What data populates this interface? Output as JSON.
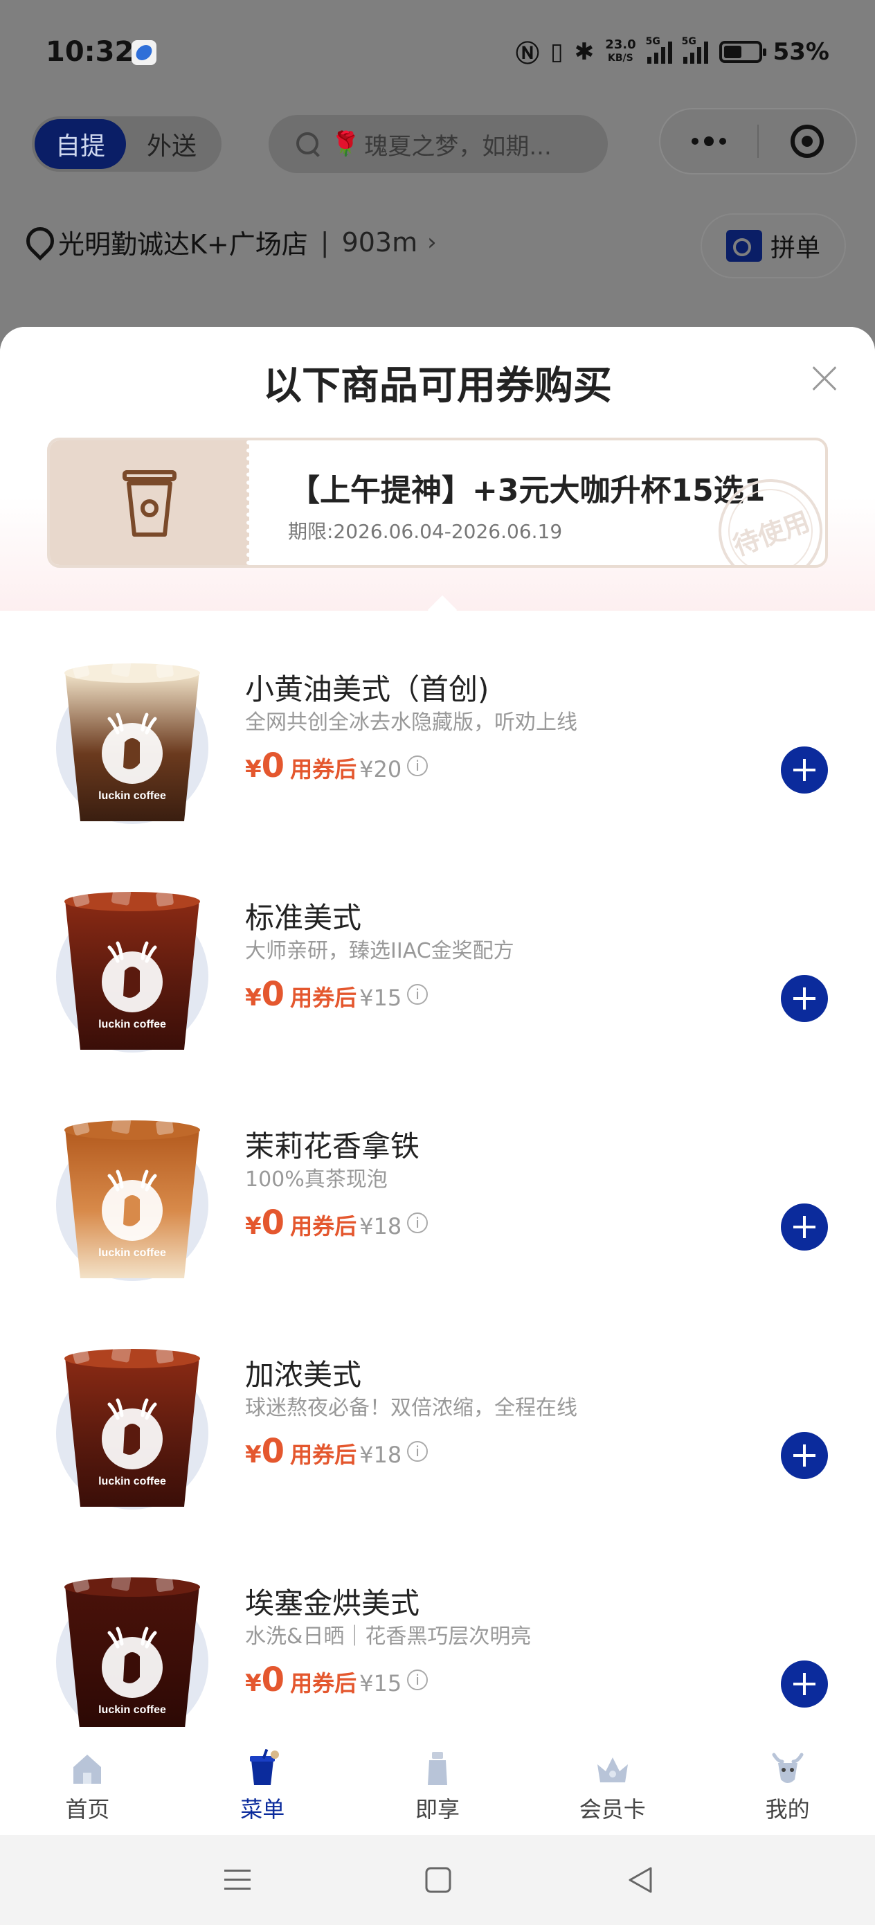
{
  "status_bar": {
    "time": "10:32",
    "network_speed": "23.0",
    "network_speed_unit": "KB/S",
    "signal_label_1": "5G",
    "signal_label_2": "5G",
    "battery_percent": "53%",
    "battery_level": 0.53
  },
  "header": {
    "mode_active": "自提",
    "mode_other": "外送",
    "search_placeholder": "瑰夏之梦，如期...",
    "store_name": "光明勤诚达K+广场店",
    "store_distance": "903m",
    "group_order_label": "拼单"
  },
  "sheet": {
    "title": "以下商品可用券购买",
    "coupon": {
      "title": "【上午提神】+3元大咖升杯15选1",
      "validity": "期限:2026.06.04-2026.06.19",
      "stamp": "待使用"
    },
    "products": [
      {
        "name": "小黄油美式（首创)",
        "desc": "全网共创全冰去水隐藏版，听劝上线",
        "currency": "¥",
        "price": "0",
        "price_label": "用券后",
        "original_price": "¥20",
        "cup_style": "latte_butter"
      },
      {
        "name": "标准美式",
        "desc": "大师亲研，臻选IIAC金奖配方",
        "currency": "¥",
        "price": "0",
        "price_label": "用券后",
        "original_price": "¥15",
        "cup_style": "americano"
      },
      {
        "name": "茉莉花香拿铁",
        "desc": "100%真茶现泡",
        "currency": "¥",
        "price": "0",
        "price_label": "用券后",
        "original_price": "¥18",
        "cup_style": "latte"
      },
      {
        "name": "加浓美式",
        "desc": "球迷熬夜必备！双倍浓缩，全程在线",
        "currency": "¥",
        "price": "0",
        "price_label": "用券后",
        "original_price": "¥18",
        "cup_style": "americano"
      },
      {
        "name": "埃塞金烘美式",
        "desc": "水洗&日晒｜花香黑巧层次明亮",
        "currency": "¥",
        "price": "0",
        "price_label": "用券后",
        "original_price": "¥15",
        "cup_style": "dark_americano"
      }
    ],
    "cup_brand": "luckin coffee"
  },
  "tabs": [
    {
      "label": "首页",
      "icon": "home-icon",
      "active": false
    },
    {
      "label": "菜单",
      "icon": "menu-cup-icon",
      "active": true
    },
    {
      "label": "即享",
      "icon": "bottle-icon",
      "active": false
    },
    {
      "label": "会员卡",
      "icon": "crown-icon",
      "active": false
    },
    {
      "label": "我的",
      "icon": "deer-icon",
      "active": false
    }
  ],
  "colors": {
    "brand_blue": "#0b2b9c",
    "price_orange": "#e4572e",
    "coupon_tan": "#e8d8cc"
  }
}
